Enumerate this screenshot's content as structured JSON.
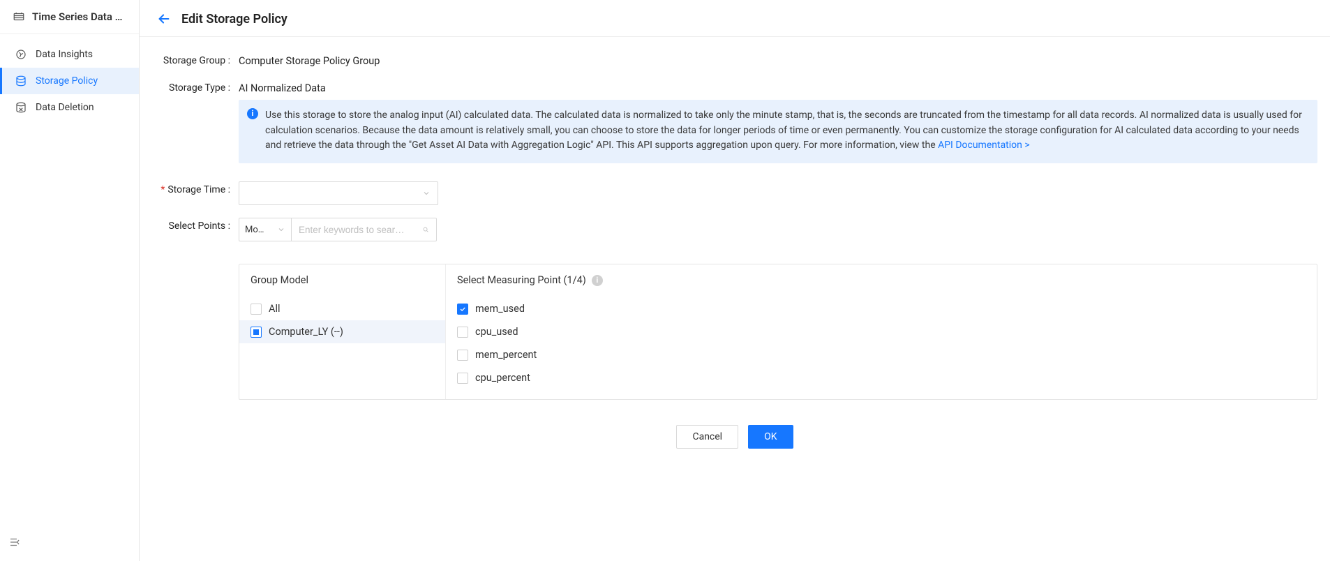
{
  "sidebar": {
    "title": "Time Series Data …",
    "items": [
      {
        "label": "Data Insights"
      },
      {
        "label": "Storage Policy"
      },
      {
        "label": "Data Deletion"
      }
    ]
  },
  "header": {
    "title": "Edit Storage Policy"
  },
  "form": {
    "storage_group_label": "Storage Group :",
    "storage_group_value": "Computer Storage Policy Group",
    "storage_type_label": "Storage Type :",
    "storage_type_value": "AI Normalized Data",
    "info_text": "Use this storage to store the analog input (AI) calculated data. The calculated data is normalized to take only the minute stamp, that is, the seconds are truncated from the timestamp for all data records. AI normalized data is usually used for calculation scenarios. Because the data amount is relatively small, you can choose to store the data for longer periods of time or even permanently. You can customize the storage configuration for AI calculated data according to your needs and retrieve the data through the \"Get Asset AI Data with Aggregation Logic\" API. This API supports aggregation upon query. For more information, view the ",
    "api_link_text": "API Documentation >",
    "storage_time_label": "Storage Time :",
    "storage_time_value": "",
    "select_points_label": "Select Points :",
    "mode_select_value": "Mo…",
    "search_placeholder": "Enter keywords to sear…",
    "group_model_header": "Group Model",
    "measuring_point_header": "Select Measuring Point (1/4)",
    "group_models": [
      {
        "label": "All",
        "state": "unchecked",
        "selected": false
      },
      {
        "label": "Computer_LY (--)",
        "state": "indeterminate",
        "selected": true
      }
    ],
    "measuring_points": [
      {
        "label": "mem_used",
        "checked": true
      },
      {
        "label": "cpu_used",
        "checked": false
      },
      {
        "label": "mem_percent",
        "checked": false
      },
      {
        "label": "cpu_percent",
        "checked": false
      }
    ]
  },
  "footer": {
    "cancel": "Cancel",
    "ok": "OK"
  }
}
